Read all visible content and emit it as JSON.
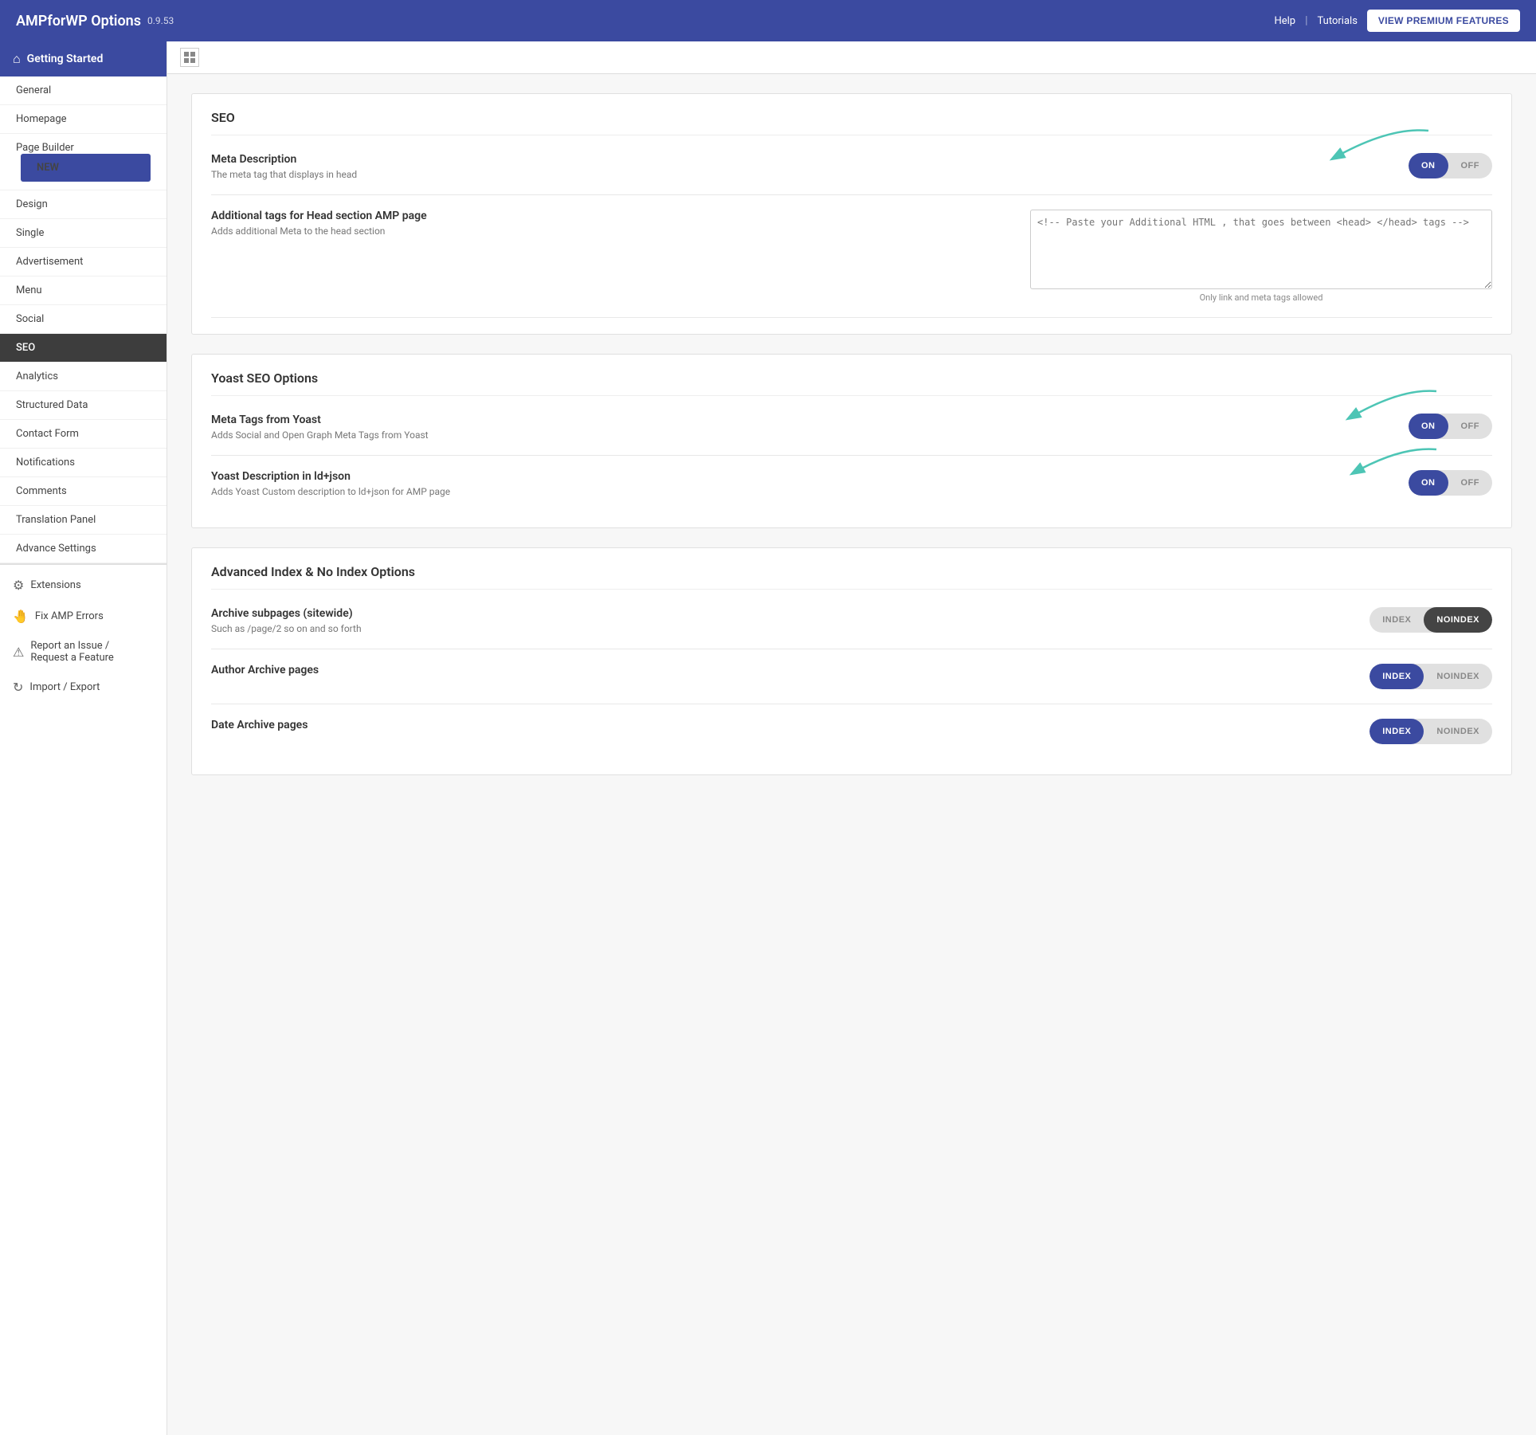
{
  "header": {
    "title": "AMPforWP Options",
    "version": "0.9.53",
    "help_label": "Help",
    "tutorials_label": "Tutorials",
    "premium_button": "VIEW PREMIUM FEATURES"
  },
  "sidebar": {
    "getting_started": "Getting Started",
    "nav_items": [
      {
        "label": "General",
        "active": false
      },
      {
        "label": "Homepage",
        "active": false
      },
      {
        "label": "Page Builder",
        "active": false,
        "badge": "NEW"
      },
      {
        "label": "Design",
        "active": false
      },
      {
        "label": "Single",
        "active": false
      },
      {
        "label": "Advertisement",
        "active": false
      },
      {
        "label": "Menu",
        "active": false
      },
      {
        "label": "Social",
        "active": false
      },
      {
        "label": "SEO",
        "active": true
      },
      {
        "label": "Analytics",
        "active": false
      },
      {
        "label": "Structured Data",
        "active": false
      },
      {
        "label": "Contact Form",
        "active": false
      },
      {
        "label": "Notifications",
        "active": false
      },
      {
        "label": "Comments",
        "active": false
      },
      {
        "label": "Translation Panel",
        "active": false
      },
      {
        "label": "Advance Settings",
        "active": false
      }
    ],
    "extensions_label": "Extensions",
    "fix_amp_errors_label": "Fix AMP Errors",
    "report_label": "Report an Issue /",
    "request_label": "Request a Feature",
    "import_export_label": "Import / Export"
  },
  "main": {
    "seo_section": {
      "title": "SEO",
      "meta_description": {
        "label": "Meta Description",
        "desc": "The meta tag that displays in head",
        "on_label": "ON",
        "off_label": "OFF",
        "state": "on"
      },
      "additional_tags": {
        "label": "Additional tags for Head section AMP page",
        "desc": "Adds additional Meta to the head section",
        "placeholder": "<!-- Paste your Additional HTML , that goes between <head> </head> tags -->",
        "hint": "Only link and meta tags allowed"
      }
    },
    "yoast_section": {
      "title": "Yoast SEO Options",
      "meta_tags_yoast": {
        "label": "Meta Tags from Yoast",
        "desc": "Adds Social and Open Graph Meta Tags from Yoast",
        "on_label": "ON",
        "off_label": "OFF",
        "state": "on"
      },
      "yoast_description": {
        "label": "Yoast Description in ld+json",
        "desc": "Adds Yoast Custom description to ld+json for AMP page",
        "on_label": "ON",
        "off_label": "OFF",
        "state": "on"
      }
    },
    "advanced_index_section": {
      "title": "Advanced Index & No Index Options",
      "archive_subpages": {
        "label": "Archive subpages (sitewide)",
        "desc": "Such as /page/2 so on and so forth",
        "index_label": "INDEX",
        "noindex_label": "NOINDEX",
        "state": "noindex"
      },
      "author_archive": {
        "label": "Author Archive pages",
        "index_label": "INDEX",
        "noindex_label": "NOINDEX",
        "state": "index"
      },
      "date_archive": {
        "label": "Date Archive pages",
        "index_label": "INDEX",
        "noindex_label": "NOINDEX",
        "state": "index"
      }
    }
  }
}
